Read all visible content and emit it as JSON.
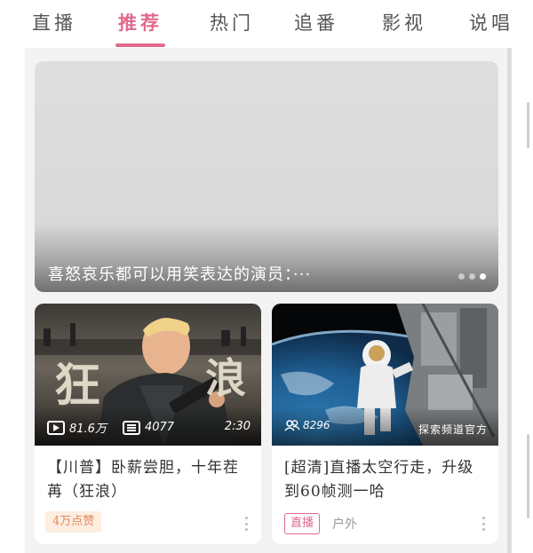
{
  "tabs": [
    {
      "label": "直播",
      "active": false
    },
    {
      "label": "推荐",
      "active": true
    },
    {
      "label": "热门",
      "active": false
    },
    {
      "label": "追番",
      "active": false
    },
    {
      "label": "影视",
      "active": false
    },
    {
      "label": "说唱",
      "active": false
    }
  ],
  "accent_color": "#e26a8d",
  "banner": {
    "caption": "喜怒哀乐都可以用笑表达的演员：···",
    "dots": 3,
    "active_dot": 3
  },
  "cards": [
    {
      "thumbnail_text": [
        "狂",
        "浪"
      ],
      "play_icon": "play-icon",
      "views": "81.6万",
      "danmaku_icon": "danmaku-icon",
      "danmaku": "4077",
      "duration": "2:30",
      "title": "【川普】卧薪尝胆，十年茬苒（狂浪）",
      "likes": "4万点赞",
      "more_icon": "more-icon"
    },
    {
      "viewer_icon": "viewers-icon",
      "viewers": "8296",
      "channel": "探索频道官方",
      "title": "[超清]直播太空行走，升级到60帧测一哈",
      "live_tag": "直播",
      "category": "户外",
      "more_icon": "more-icon"
    }
  ]
}
